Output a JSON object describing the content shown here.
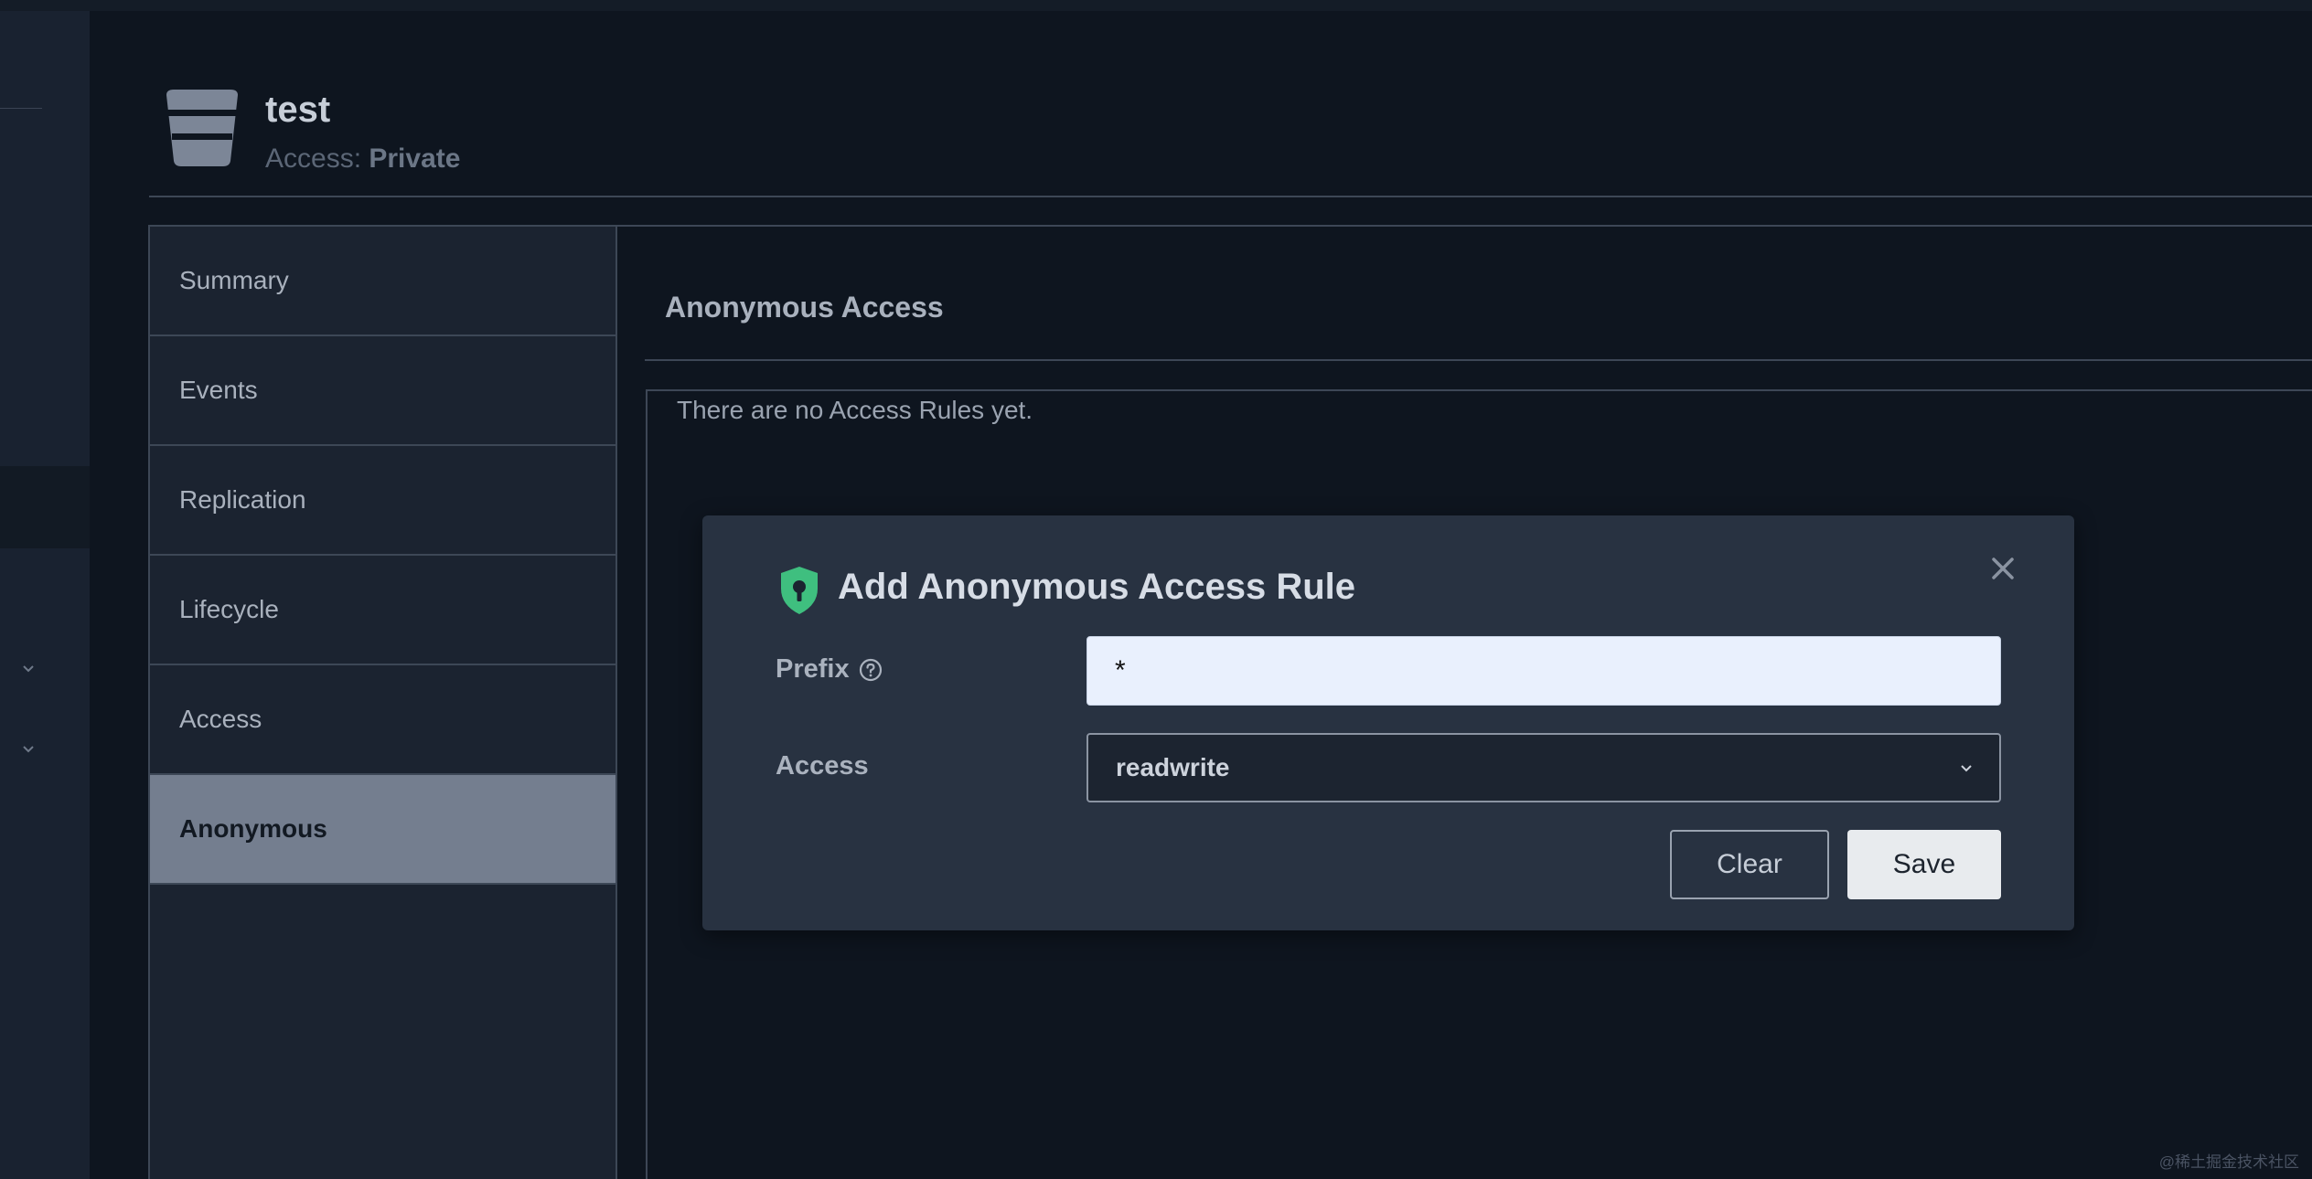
{
  "bucket": {
    "name": "test",
    "access_label": "Access:",
    "access_value": "Private"
  },
  "tabs": [
    {
      "label": "Summary",
      "active": false
    },
    {
      "label": "Events",
      "active": false
    },
    {
      "label": "Replication",
      "active": false
    },
    {
      "label": "Lifecycle",
      "active": false
    },
    {
      "label": "Access",
      "active": false
    },
    {
      "label": "Anonymous",
      "active": true
    }
  ],
  "section": {
    "title": "Anonymous Access",
    "empty_text": "There are no Access Rules yet."
  },
  "modal": {
    "title": "Add Anonymous Access Rule",
    "prefix_label": "Prefix",
    "prefix_value": "*",
    "access_label": "Access",
    "access_value": "readwrite",
    "clear_label": "Clear",
    "save_label": "Save"
  },
  "icons": {
    "bucket": "bucket-icon",
    "shield": "shield-key-icon",
    "help": "help-circle-icon",
    "close": "close-icon",
    "chevron": "chevron-down-icon"
  },
  "colors": {
    "background": "#0e151f",
    "modal": "#283241",
    "accent_green": "#3fbf7f",
    "active_tab": "#747e8f"
  },
  "watermark": "@稀土掘金技术社区"
}
